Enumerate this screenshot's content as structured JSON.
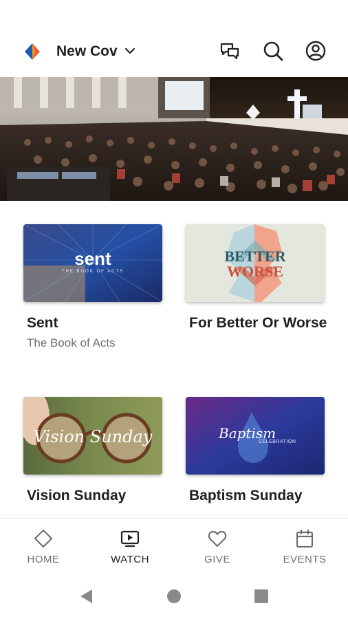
{
  "header": {
    "church_name": "New Cov",
    "icons": [
      "logo-icon",
      "chevron-down-icon",
      "chat-icon",
      "search-icon",
      "account-icon"
    ]
  },
  "hero": {
    "image": "church-congregation-photo"
  },
  "series": [
    {
      "title": "Sent",
      "subtitle": "The Book of Acts",
      "art_text": "sent",
      "art_subtext": "THE BOOK OF ACTS"
    },
    {
      "title": "For Better Or Worse",
      "subtitle": "",
      "art_text": "BETTER",
      "art_text2": "WORSE"
    },
    {
      "title": "Vision Sunday",
      "subtitle": "",
      "art_text": "Vision Sunday"
    },
    {
      "title": "Baptism Sunday",
      "subtitle": "",
      "art_text": "Baptism",
      "art_subtext": "CELEBRATION"
    }
  ],
  "bottom_nav": [
    {
      "label": "HOME",
      "icon": "diamond-icon",
      "active": false
    },
    {
      "label": "WATCH",
      "icon": "tv-play-icon",
      "active": true
    },
    {
      "label": "GIVE",
      "icon": "heart-icon",
      "active": false
    },
    {
      "label": "EVENTS",
      "icon": "calendar-icon",
      "active": false
    }
  ],
  "colors": {
    "text_primary": "#202124",
    "text_secondary": "#707070",
    "logo_orange": "#E8622A",
    "logo_blue": "#1E5AA8"
  }
}
